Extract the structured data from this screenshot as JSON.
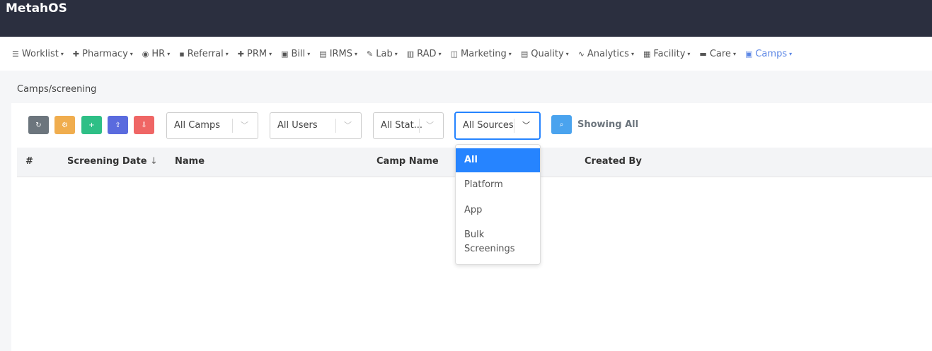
{
  "app": {
    "title": "MetahOS"
  },
  "nav": [
    {
      "icon": "list-icon",
      "glyph": "☰",
      "label": "Worklist",
      "active": false
    },
    {
      "icon": "plus-icon",
      "glyph": "✚",
      "label": "Pharmacy",
      "active": false
    },
    {
      "icon": "user-circle-icon",
      "glyph": "◉",
      "label": "HR",
      "active": false
    },
    {
      "icon": "referral-icon",
      "glyph": "▪",
      "label": "Referral",
      "active": false
    },
    {
      "icon": "plus-icon",
      "glyph": "✚",
      "label": "PRM",
      "active": false
    },
    {
      "icon": "money-icon",
      "glyph": "▣",
      "label": "Bill",
      "active": false
    },
    {
      "icon": "id-card-icon",
      "glyph": "▤",
      "label": "IRMS",
      "active": false
    },
    {
      "icon": "pen-icon",
      "glyph": "✎",
      "label": "Lab",
      "active": false
    },
    {
      "icon": "film-icon",
      "glyph": "▥",
      "label": "RAD",
      "active": false
    },
    {
      "icon": "bag-icon",
      "glyph": "◫",
      "label": "Marketing",
      "active": false
    },
    {
      "icon": "clipboard-icon",
      "glyph": "▤",
      "label": "Quality",
      "active": false
    },
    {
      "icon": "pulse-icon",
      "glyph": "∿",
      "label": "Analytics",
      "active": false
    },
    {
      "icon": "building-icon",
      "glyph": "▦",
      "label": "Facility",
      "active": false
    },
    {
      "icon": "bed-icon",
      "glyph": "▬",
      "label": "Care",
      "active": false
    },
    {
      "icon": "briefcase-icon",
      "glyph": "▣",
      "label": "Camps",
      "active": true
    }
  ],
  "breadcrumb": "Camps/screening",
  "toolbar": {
    "buttons": [
      {
        "name": "refresh-button",
        "icon": "refresh-icon",
        "glyph": "↻",
        "color": "#6c757d"
      },
      {
        "name": "settings-button",
        "icon": "gear-icon",
        "glyph": "⚙",
        "color": "#f0ad4e"
      },
      {
        "name": "add-button",
        "icon": "plus-icon",
        "glyph": "+",
        "color": "#2ebf86"
      },
      {
        "name": "upload-button",
        "icon": "upload-icon",
        "glyph": "⇪",
        "color": "#5a6bde"
      },
      {
        "name": "download-button",
        "icon": "download-icon",
        "glyph": "⇩",
        "color": "#ef6665"
      }
    ],
    "filters": {
      "camps": "All Camps",
      "users": "All Users",
      "status": "All Stat...",
      "sources": "All Sources"
    },
    "showing": "Showing All"
  },
  "table": {
    "columns": [
      "#",
      "Screening Date",
      "Name",
      "Camp Name",
      "Created By"
    ],
    "sort_icon": "arrow-down-icon",
    "rows": []
  },
  "sources_dropdown": {
    "options": [
      "All",
      "Platform",
      "App",
      "Bulk Screenings"
    ],
    "selected": "All"
  },
  "colors": {
    "topbar": "#2b2f3f",
    "accent": "#2684ff",
    "nav_active": "#5b86e5"
  }
}
